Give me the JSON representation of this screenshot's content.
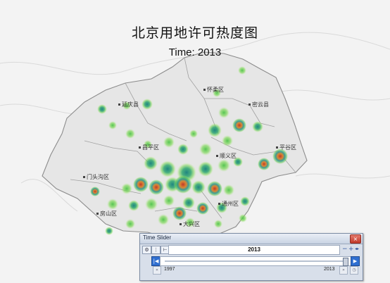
{
  "map": {
    "title": "北京用地许可热度图",
    "subtitle": "Time: 2013",
    "district_labels": [
      {
        "name": "怀柔区"
      },
      {
        "name": "延庆县"
      },
      {
        "name": "密云县"
      },
      {
        "name": "昌平区"
      },
      {
        "name": "顺义区"
      },
      {
        "name": "平谷区"
      },
      {
        "name": "门头沟区"
      },
      {
        "name": "通州区"
      },
      {
        "name": "房山区"
      },
      {
        "name": "大兴区"
      }
    ],
    "heat_colors": {
      "low": "#5ec24f",
      "mid": "#1f8f86",
      "high": "#c0392b"
    }
  },
  "time_slider": {
    "title": "Time Slider",
    "close_glyph": "×",
    "current_time": "2013",
    "start": "1997",
    "end": "2013",
    "position_fraction": 1.0,
    "step_glyphs": {
      "prev": "|◀",
      "next": "▶|",
      "play": "▶"
    },
    "zoom_glyphs": {
      "minus": "−",
      "plus": "+",
      "extra": "◂▸"
    }
  }
}
